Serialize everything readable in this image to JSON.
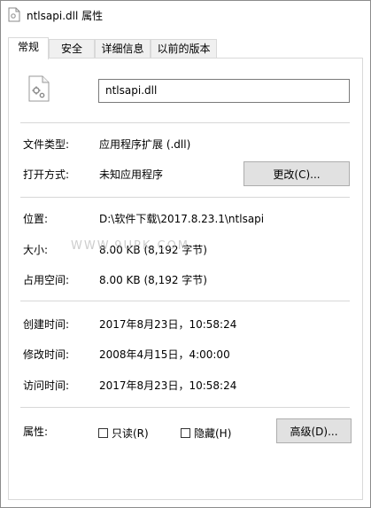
{
  "window": {
    "title": "ntlsapi.dll 属性"
  },
  "tabs": [
    {
      "label": "常规",
      "active": true
    },
    {
      "label": "安全",
      "active": false
    },
    {
      "label": "详细信息",
      "active": false
    },
    {
      "label": "以前的版本",
      "active": false
    }
  ],
  "general": {
    "filename": "ntlsapi.dll",
    "file_type_label": "文件类型:",
    "file_type_value": "应用程序扩展 (.dll)",
    "opens_with_label": "打开方式:",
    "opens_with_value": "未知应用程序",
    "change_button": "更改(C)...",
    "location_label": "位置:",
    "location_value": "D:\\软件下载\\2017.8.23.1\\ntlsapi",
    "size_label": "大小:",
    "size_value": "8.00 KB (8,192 字节)",
    "size_on_disk_label": "占用空间:",
    "size_on_disk_value": "8.00 KB (8,192 字节)",
    "created_label": "创建时间:",
    "created_value": "2017年8月23日，10:58:24",
    "modified_label": "修改时间:",
    "modified_value": "2008年4月15日，4:00:00",
    "accessed_label": "访问时间:",
    "accessed_value": "2017年8月23日，10:58:24",
    "attributes_label": "属性:",
    "readonly_label": "只读(R)",
    "hidden_label": "隐藏(H)",
    "advanced_button": "高级(D)..."
  },
  "watermark": "WWW.9UPK.COM",
  "colors": {
    "button_bg": "#e1e1e1",
    "separator": "#d7d7d7",
    "tab_inactive": "#f0f0f0"
  }
}
